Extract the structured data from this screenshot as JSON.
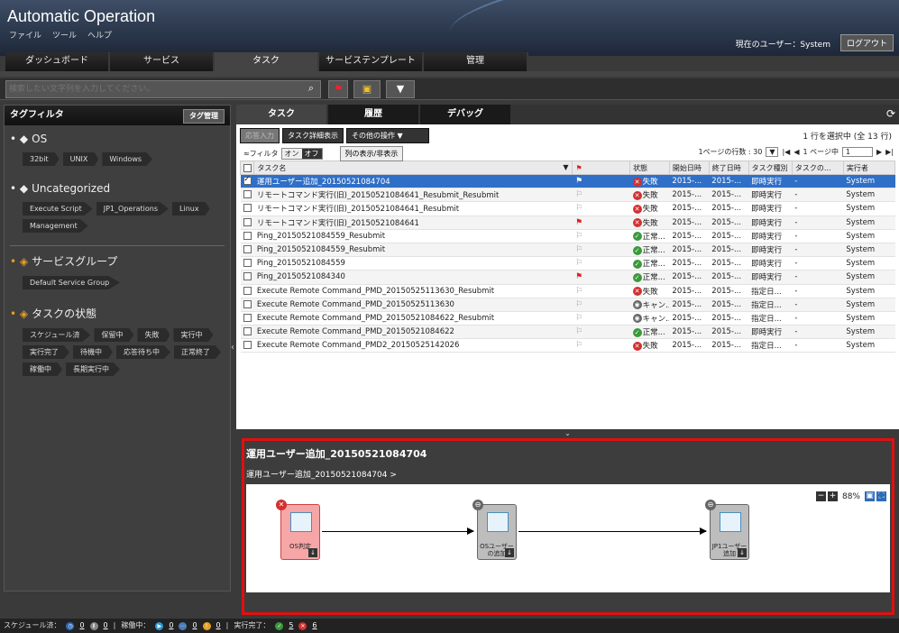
{
  "header": {
    "app_title": "Automatic Operation",
    "menus": [
      "ファイル",
      "ツール",
      "ヘルプ"
    ],
    "current_user": "現在のユーザー：System",
    "logout": "ログアウト"
  },
  "nav": {
    "tabs": [
      "ダッシュボード",
      "サービス",
      "タスク",
      "サービステンプレート",
      "管理"
    ],
    "active": "タスク"
  },
  "search": {
    "placeholder": "検索したい文字列を入力してください。"
  },
  "tagfilter": {
    "title": "タグフィルタ",
    "manage_button": "タグ管理",
    "groups": [
      {
        "name": "OS",
        "chips": [
          "32bit",
          "UNIX",
          "Windows"
        ]
      },
      {
        "name": "Uncategorized",
        "chips": [
          "Execute Script",
          "JP1_Operations",
          "Linux",
          "Management"
        ]
      },
      {
        "name": "サービスグループ",
        "chips": [
          "Default Service Group"
        ]
      },
      {
        "name": "タスクの状態",
        "chips": [
          "スケジュール済",
          "保留中",
          "失敗",
          "実行中",
          "実行完了",
          "待機中",
          "応答待ち中",
          "正常終了",
          "稼働中",
          "長期実行中"
        ]
      }
    ]
  },
  "right": {
    "tabs": [
      "タスク",
      "履歴",
      "デバッグ"
    ],
    "toolbar": {
      "respond": "応答入力",
      "details": "タスク詳細表示",
      "other": "その他の操作",
      "selection": "1 行を選択中 (全 13 行)"
    },
    "toolbar2": {
      "filter": "≈フィルタ",
      "on": "オン",
      "off": "オフ",
      "columns": "列の表示/非表示",
      "rows_per_page": "1ページの行数 : 30",
      "page_label": "1 ページ中",
      "page_value": "1"
    },
    "columns": [
      "タスク名",
      "",
      "状態",
      "開始日時",
      "終了日時",
      "タスク種別",
      "タスクの...",
      "実行者"
    ],
    "rows": [
      {
        "name": "運用ユーザー追加_20150521084704",
        "flag": "white",
        "status": "失敗",
        "status_color": "#d23030",
        "start": "2015-...",
        "end": "2015-...",
        "type": "即時実行",
        "x": "-",
        "user": "System",
        "selected": true
      },
      {
        "name": "リモートコマンド実行(旧)_20150521084641_Resubmit_Resubmit",
        "flag": "empty",
        "status": "失敗",
        "status_color": "#d23030",
        "start": "2015-...",
        "end": "2015-...",
        "type": "即時実行",
        "x": "-",
        "user": "System"
      },
      {
        "name": "リモートコマンド実行(旧)_20150521084641_Resubmit",
        "flag": "empty",
        "status": "失敗",
        "status_color": "#d23030",
        "start": "2015-...",
        "end": "2015-...",
        "type": "即時実行",
        "x": "-",
        "user": "System"
      },
      {
        "name": "リモートコマンド実行(旧)_20150521084641",
        "flag": "red",
        "status": "失敗",
        "status_color": "#d23030",
        "start": "2015-...",
        "end": "2015-...",
        "type": "即時実行",
        "x": "-",
        "user": "System"
      },
      {
        "name": "Ping_20150521084559_Resubmit",
        "flag": "empty",
        "status": "正常...",
        "status_color": "#3a9a3a",
        "start": "2015-...",
        "end": "2015-...",
        "type": "即時実行",
        "x": "-",
        "user": "System"
      },
      {
        "name": "Ping_20150521084559_Resubmit",
        "flag": "empty",
        "status": "正常...",
        "status_color": "#3a9a3a",
        "start": "2015-...",
        "end": "2015-...",
        "type": "即時実行",
        "x": "-",
        "user": "System"
      },
      {
        "name": "Ping_20150521084559",
        "flag": "empty",
        "status": "正常...",
        "status_color": "#3a9a3a",
        "start": "2015-...",
        "end": "2015-...",
        "type": "即時実行",
        "x": "-",
        "user": "System"
      },
      {
        "name": "Ping_20150521084340",
        "flag": "red",
        "status": "正常...",
        "status_color": "#3a9a3a",
        "start": "2015-...",
        "end": "2015-...",
        "type": "即時実行",
        "x": "-",
        "user": "System"
      },
      {
        "name": "Execute Remote Command_PMD_20150525113630_Resubmit",
        "flag": "empty",
        "status": "失敗",
        "status_color": "#d23030",
        "start": "2015-...",
        "end": "2015-...",
        "type": "指定日...",
        "x": "-",
        "user": "System"
      },
      {
        "name": "Execute Remote Command_PMD_20150525113630",
        "flag": "empty",
        "status": "キャン...",
        "status_color": "#666666",
        "start": "2015-...",
        "end": "2015-...",
        "type": "指定日...",
        "x": "-",
        "user": "System"
      },
      {
        "name": "Execute Remote Command_PMD_20150521084622_Resubmit",
        "flag": "empty",
        "status": "キャン...",
        "status_color": "#666666",
        "start": "2015-...",
        "end": "2015-...",
        "type": "指定日...",
        "x": "-",
        "user": "System"
      },
      {
        "name": "Execute Remote Command_PMD_20150521084622",
        "flag": "empty",
        "status": "正常...",
        "status_color": "#3a9a3a",
        "start": "2015-...",
        "end": "2015-...",
        "type": "即時実行",
        "x": "-",
        "user": "System"
      },
      {
        "name": "Execute Remote Command_PMD2_20150525142026",
        "flag": "empty",
        "status": "失敗",
        "status_color": "#d23030",
        "start": "2015-...",
        "end": "2015-...",
        "type": "指定日...",
        "x": "-",
        "user": "System"
      }
    ]
  },
  "detail": {
    "title": "運用ユーザー追加_20150521084704",
    "breadcrumb": "運用ユーザー追加_20150521084704 >",
    "zoom": "88%",
    "nodes": [
      {
        "label": "OS判定",
        "state": "failed"
      },
      {
        "label": "OSユーザーの追加",
        "state": "pending"
      },
      {
        "label": "JP1ユーザー追加",
        "state": "pending"
      }
    ]
  },
  "footer": {
    "scheduled": "スケジュール済：",
    "scheduled_count": "0",
    "held_count": "0",
    "running": "稼働中：",
    "running_count": "0",
    "waiting_count": "0",
    "response_count": "0",
    "completed": "実行完了：",
    "completed_ok": "5",
    "completed_fail": "6"
  }
}
